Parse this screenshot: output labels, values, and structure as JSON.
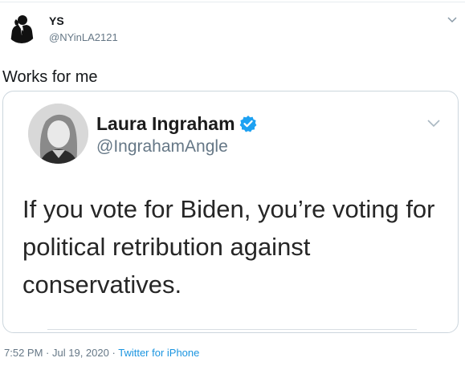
{
  "tweet": {
    "author_name": "YS",
    "author_handle": "@NYinLA2121",
    "text": "Works for me",
    "time": "7:52 PM",
    "separator": "·",
    "date": "Jul 19, 2020",
    "source": "Twitter for iPhone"
  },
  "embedded_tweet": {
    "author_name": "Laura Ingraham",
    "author_handle": "@IngrahamAngle",
    "verified": true,
    "text_lines": [
      "If you vote for Biden, you’re voting for",
      "political retribution against",
      "conservatives."
    ]
  },
  "icons": {
    "outer_avatar": "silhouette-phone-avatar-icon",
    "verified": "verified-badge-icon",
    "more": "chevron-down-icon"
  },
  "colors": {
    "accent": "#1b95e0",
    "verified": "#1da1f2",
    "muted": "#657786",
    "border": "#ccd6dd"
  }
}
